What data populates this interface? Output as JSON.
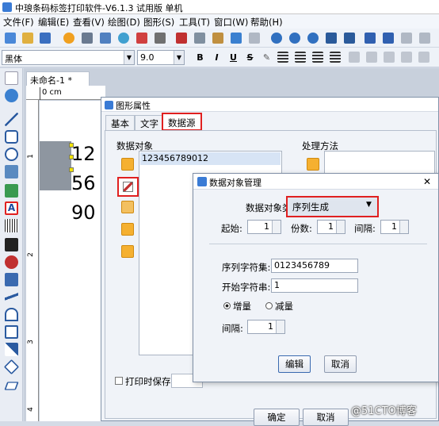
{
  "app": {
    "title": "中琅条码标签打印软件-V6.1.3 试用版 单机"
  },
  "menu": [
    "文件(F)",
    "编辑(E)",
    "查看(V)",
    "绘图(D)",
    "图形(S)",
    "工具(T)",
    "窗口(W)",
    "帮助(H)"
  ],
  "font": {
    "family": "黑体",
    "size": "9.0"
  },
  "format_buttons": [
    "B",
    "I",
    "U",
    "S",
    "✎"
  ],
  "document": {
    "tab_label": "未命名-1 *",
    "ruler_label": "0 cm",
    "ruler_left_marks": [
      "1",
      "2",
      "3",
      "4"
    ],
    "canvas_lines": [
      "12",
      "56",
      "90"
    ]
  },
  "shape_dialog": {
    "title": "图形属性",
    "tabs": [
      "基本",
      "文字",
      "数据源"
    ],
    "data_objects_label": "数据对象",
    "data_object_item": "123456789012",
    "process_label": "处理方法",
    "print_save_label": "打印时保存",
    "ok_label": "确定",
    "cancel_label": "取消"
  },
  "data_dialog": {
    "title": "数据对象管理",
    "type_label": "数据对象类型:",
    "type_value": "序列生成",
    "start_label": "起始:",
    "start_value": "1",
    "count_label": "份数:",
    "count_value": "1",
    "interval_label": "间隔:",
    "interval_value": "1",
    "charset_label": "序列字符集:",
    "charset_value": "0123456789",
    "start_str_label": "开始字符串:",
    "start_str_value": "1",
    "increase_label": "增量",
    "decrease_label": "减量",
    "step_label": "间隔:",
    "step_value": "1",
    "edit_label": "编辑",
    "cancel_label": "取消"
  },
  "watermark": "@51CTO博客",
  "colors": {
    "highlight": "#e02020",
    "accent": "#3a7bd5"
  }
}
